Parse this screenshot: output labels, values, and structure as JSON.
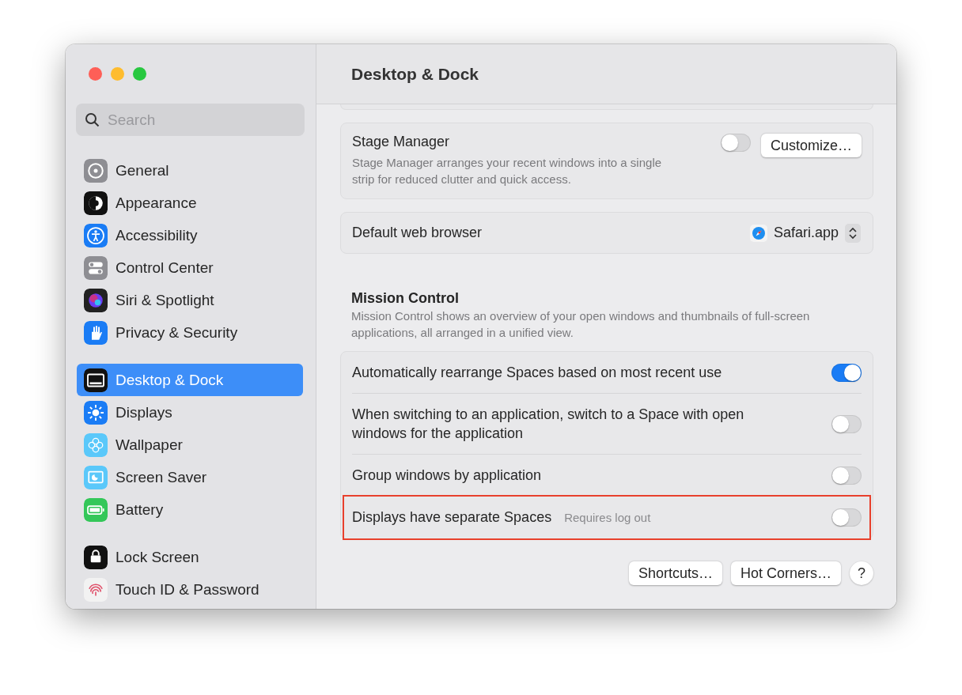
{
  "window": {
    "title": "Desktop & Dock"
  },
  "search": {
    "placeholder": "Search"
  },
  "sidebar": {
    "sections": [
      {
        "items": [
          {
            "label": "General",
            "selected": false,
            "kind": "gear"
          },
          {
            "label": "Appearance",
            "selected": false,
            "kind": "appearance"
          },
          {
            "label": "Accessibility",
            "selected": false,
            "kind": "accessibility"
          },
          {
            "label": "Control Center",
            "selected": false,
            "kind": "switches"
          },
          {
            "label": "Siri & Spotlight",
            "selected": false,
            "kind": "siri"
          },
          {
            "label": "Privacy & Security",
            "selected": false,
            "kind": "hand"
          }
        ]
      },
      {
        "items": [
          {
            "label": "Desktop & Dock",
            "selected": true,
            "kind": "dock"
          },
          {
            "label": "Displays",
            "selected": false,
            "kind": "sun"
          },
          {
            "label": "Wallpaper",
            "selected": false,
            "kind": "flower"
          },
          {
            "label": "Screen Saver",
            "selected": false,
            "kind": "screensaver"
          },
          {
            "label": "Battery",
            "selected": false,
            "kind": "battery"
          }
        ]
      },
      {
        "items": [
          {
            "label": "Lock Screen",
            "selected": false,
            "kind": "lock"
          },
          {
            "label": "Touch ID & Password",
            "selected": false,
            "kind": "fingerprint"
          }
        ]
      }
    ]
  },
  "stage_manager": {
    "title": "Stage Manager",
    "description": "Stage Manager arranges your recent windows into a single strip for reduced clutter and quick access.",
    "on": false,
    "button": "Customize…"
  },
  "default_browser": {
    "label": "Default web browser",
    "value": "Safari.app"
  },
  "mission_control": {
    "title": "Mission Control",
    "description": "Mission Control shows an overview of your open windows and thumbnails of full-screen applications, all arranged in a unified view.",
    "rows": [
      {
        "label": "Automatically rearrange Spaces based on most recent use",
        "on": true,
        "highlighted": false
      },
      {
        "label": "When switching to an application, switch to a Space with open windows for the application",
        "on": false,
        "highlighted": false
      },
      {
        "label": "Group windows by application",
        "on": false,
        "highlighted": false
      },
      {
        "label": "Displays have separate Spaces",
        "note": "Requires log out",
        "on": false,
        "highlighted": true
      }
    ]
  },
  "footer_buttons": [
    "Shortcuts…",
    "Hot Corners…"
  ],
  "help_button": "?"
}
